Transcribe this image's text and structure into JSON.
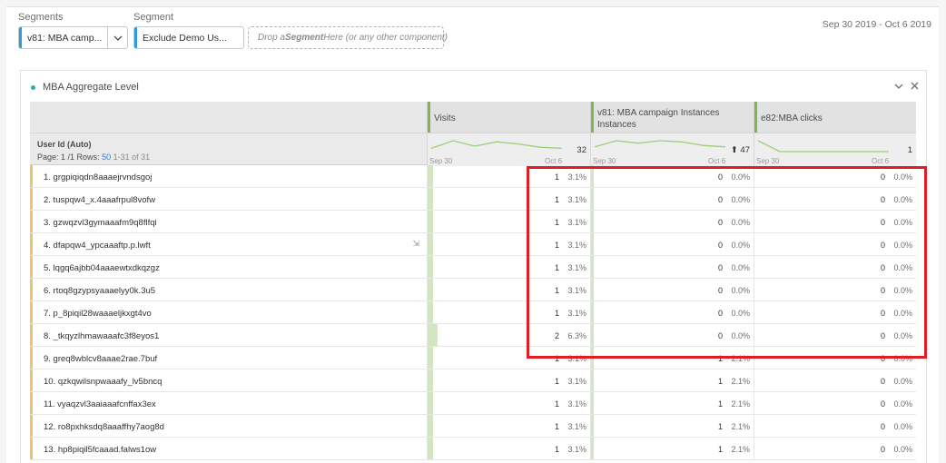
{
  "segments_label": "Segments",
  "segment_label": "Segment",
  "segment_pill_1": "v81: MBA camp...",
  "segment_pill_2": "Exclude Demo Us...",
  "drop_zone": {
    "prefix": "Drop a ",
    "bold": "Segment",
    "suffix": " Here (or any other component)"
  },
  "date_range": "Sep 30 2019 - Oct 6 2019",
  "panel_title": "MBA Aggregate Level",
  "columns": [
    {
      "title": "Visits",
      "subtitle": ""
    },
    {
      "title": "v81: MBA campaign Instances",
      "subtitle": "Instances"
    },
    {
      "title": "e82:MBA clicks",
      "subtitle": ""
    }
  ],
  "dimension": {
    "name": "User Id (Auto)",
    "page_info": "Page: 1 /1 Rows:",
    "rows_value": "50",
    "range": "1-31 of 31"
  },
  "summary": [
    {
      "total": "32",
      "start": "Sep 30",
      "end": "Oct 6",
      "trend": [
        3,
        10,
        5,
        9,
        7,
        4,
        3
      ]
    },
    {
      "total": "⬆ 47",
      "start": "Sep 30",
      "end": "Oct 6",
      "trend": [
        4,
        9,
        7,
        9,
        8,
        5,
        4
      ]
    },
    {
      "total": "1",
      "start": "Sep 30",
      "end": "Oct 6",
      "trend": [
        2,
        0,
        0,
        0,
        0,
        0,
        0
      ]
    }
  ],
  "rows": [
    {
      "name": "1. grgpiqiqdn8aaaejrvndsgoj",
      "visits": "1",
      "visits_pct": "3.1%",
      "visits_frac": 0.031,
      "inst": "0",
      "inst_pct": "0.0%",
      "clicks": "0",
      "clicks_pct": "0.0%"
    },
    {
      "name": "2. tuspqw4_x.4aaafrpul8vofw",
      "visits": "1",
      "visits_pct": "3.1%",
      "visits_frac": 0.031,
      "inst": "0",
      "inst_pct": "0.0%",
      "clicks": "0",
      "clicks_pct": "0.0%"
    },
    {
      "name": "3. gzwqzvl3gymaaafm9q8flfqi",
      "visits": "1",
      "visits_pct": "3.1%",
      "visits_frac": 0.031,
      "inst": "0",
      "inst_pct": "0.0%",
      "clicks": "0",
      "clicks_pct": "0.0%"
    },
    {
      "name": "4. dfapqw4_ypcaaaftp.p.lwft",
      "visits": "1",
      "visits_pct": "3.1%",
      "visits_frac": 0.031,
      "inst": "0",
      "inst_pct": "0.0%",
      "clicks": "0",
      "clicks_pct": "0.0%"
    },
    {
      "name": "5. lqgq6ajbb04aaaewtxdkqzgz",
      "visits": "1",
      "visits_pct": "3.1%",
      "visits_frac": 0.031,
      "inst": "0",
      "inst_pct": "0.0%",
      "clicks": "0",
      "clicks_pct": "0.0%"
    },
    {
      "name": "6. rtoq8gzypsyaaaelyy0k.3u5",
      "visits": "1",
      "visits_pct": "3.1%",
      "visits_frac": 0.031,
      "inst": "0",
      "inst_pct": "0.0%",
      "clicks": "0",
      "clicks_pct": "0.0%"
    },
    {
      "name": "7. p_8piqil28waaaeljkxgt4vo",
      "visits": "1",
      "visits_pct": "3.1%",
      "visits_frac": 0.031,
      "inst": "0",
      "inst_pct": "0.0%",
      "clicks": "0",
      "clicks_pct": "0.0%"
    },
    {
      "name": "8. _tkqyzlhmawaaafc3f8eyos1",
      "visits": "2",
      "visits_pct": "6.3%",
      "visits_frac": 0.063,
      "inst": "0",
      "inst_pct": "0.0%",
      "clicks": "0",
      "clicks_pct": "0.0%"
    },
    {
      "name": "9. greq8wblcv8aaae2rae.7buf",
      "visits": "1",
      "visits_pct": "3.1%",
      "visits_frac": 0.031,
      "inst": "1",
      "inst_pct": "2.1%",
      "clicks": "0",
      "clicks_pct": "0.0%"
    },
    {
      "name": "10. qzkqwilsnpwaaafy_lv5bncq",
      "visits": "1",
      "visits_pct": "3.1%",
      "visits_frac": 0.031,
      "inst": "1",
      "inst_pct": "2.1%",
      "clicks": "0",
      "clicks_pct": "0.0%"
    },
    {
      "name": "11. vyaqzvl3aaiaaafcnffax3ex",
      "visits": "1",
      "visits_pct": "3.1%",
      "visits_frac": 0.031,
      "inst": "1",
      "inst_pct": "2.1%",
      "clicks": "0",
      "clicks_pct": "0.0%"
    },
    {
      "name": "12. ro8pxhksdq8aaaffhy7aog8d",
      "visits": "1",
      "visits_pct": "3.1%",
      "visits_frac": 0.031,
      "inst": "1",
      "inst_pct": "2.1%",
      "clicks": "0",
      "clicks_pct": "0.0%"
    },
    {
      "name": "13. hp8piqil5fcaaad.falws1ow",
      "visits": "1",
      "visits_pct": "3.1%",
      "visits_frac": 0.031,
      "inst": "1",
      "inst_pct": "2.1%",
      "clicks": "0",
      "clicks_pct": "0.0%"
    }
  ],
  "icons": {
    "chevron": "chevron-down-icon",
    "close": "close-icon",
    "breakdown": "breakdown-icon"
  },
  "colors": {
    "metric_accent": "#7fb84a",
    "bar_fill": "#d2e7bf",
    "row_accent": "#f0c36a",
    "highlight": "#e31b23",
    "segment_accent": "#2d9cdb"
  }
}
